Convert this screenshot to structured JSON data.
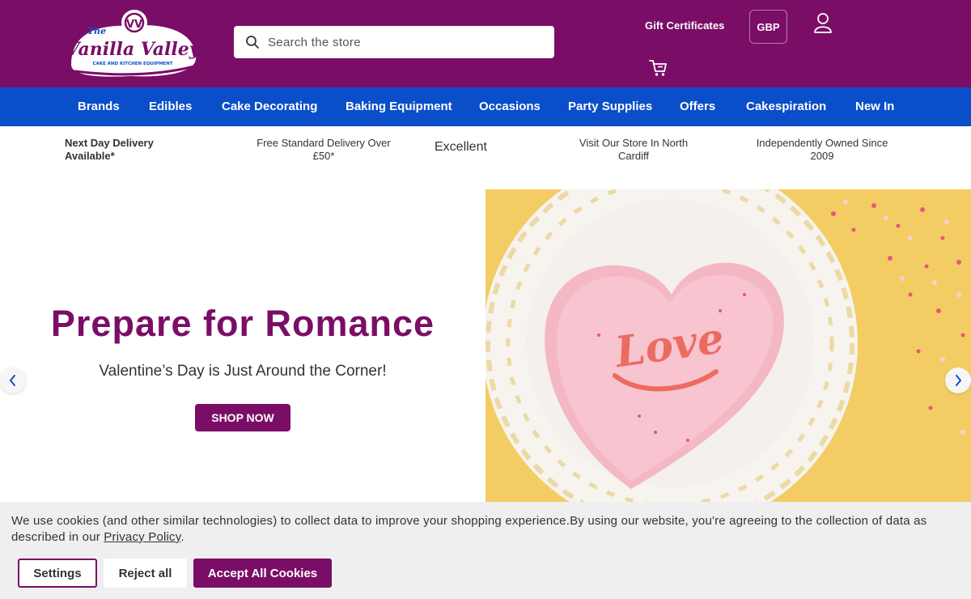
{
  "header": {
    "logo_text_small": "The",
    "logo_text_main": "Vanilla Valley",
    "logo_tagline": "CAKE AND KITCHEN EQUIPMENT",
    "search_placeholder": "Search the store",
    "gift_certificates": "Gift Certificates",
    "currency": "GBP",
    "account_icon": "user-icon",
    "cart_icon": "cart-icon",
    "brand_color": "#7a0e67"
  },
  "nav": {
    "color": "#0a4ec9",
    "items": [
      {
        "label": "Brands"
      },
      {
        "label": "Edibles"
      },
      {
        "label": "Cake Decorating"
      },
      {
        "label": "Baking Equipment"
      },
      {
        "label": "Occasions"
      },
      {
        "label": "Party Supplies"
      },
      {
        "label": "Offers"
      },
      {
        "label": "Cakespiration"
      },
      {
        "label": "New In"
      }
    ]
  },
  "usp": {
    "next_day_line1": "Next Day Delivery",
    "next_day_line2": "Available*",
    "free_delivery_line1": "Free Standard Delivery Over",
    "free_delivery_line2": "£50*",
    "rating": "Excellent",
    "store_line1": "Visit Our Store In North",
    "store_line2": "Cardiff",
    "owned_line1": "Independently Owned Since",
    "owned_line2": "2009"
  },
  "hero": {
    "title": "Prepare for Romance",
    "subtitle": "Valentine’s Day is Just Around the Corner!",
    "cta": "SHOP NOW",
    "cake_text": "Love",
    "prev_icon": "chevron-left-icon",
    "next_icon": "chevron-right-icon"
  },
  "cookie": {
    "text_before": "We use cookies (and other similar technologies) to collect data to improve your shopping experience.By using our website, you're agreeing to the collection of data as described in our ",
    "link": "Privacy Policy",
    "text_after": ".",
    "settings": "Settings",
    "reject": "Reject all",
    "accept": "Accept All Cookies"
  }
}
